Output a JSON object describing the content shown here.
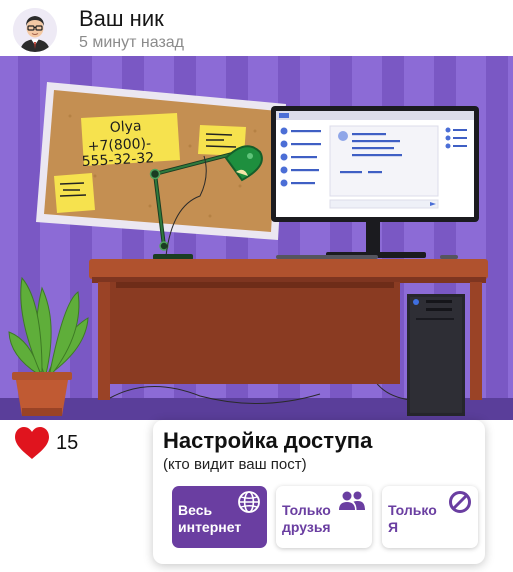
{
  "post": {
    "author_name": "Ваш ник",
    "time": "5 минут назад"
  },
  "scene": {
    "sticky_note": {
      "name": "Olya",
      "phone_line1": "+7(800)-",
      "phone_line2": "555-32-32"
    }
  },
  "likes": {
    "count": "15",
    "color": "#e0141e"
  },
  "access": {
    "title": "Настройка доступа",
    "subtitle": "(кто видит ваш пост)",
    "accent": "#6a3ea1",
    "options": [
      {
        "label": "Весь\nинтернет",
        "icon": "globe-icon",
        "selected": true
      },
      {
        "label": "Только\nдрузья",
        "icon": "users-icon",
        "selected": false
      },
      {
        "label": "Только\nЯ",
        "icon": "blocked-icon",
        "selected": false
      }
    ]
  }
}
